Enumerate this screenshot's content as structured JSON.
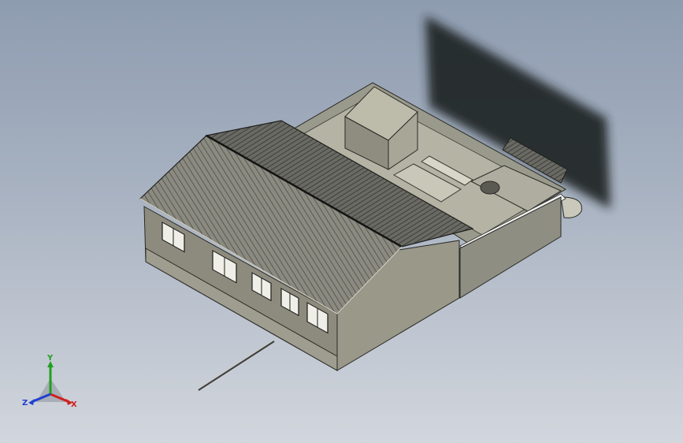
{
  "viewport": {
    "background_top": "#8e9cb0",
    "background_bottom": "#d2d6dd",
    "model": "courtyard-house-3d"
  },
  "triad": {
    "x_label": "X",
    "y_label": "Y",
    "z_label": "Z",
    "x_color": "#d02020",
    "y_color": "#20a020",
    "z_color": "#2040d0"
  }
}
